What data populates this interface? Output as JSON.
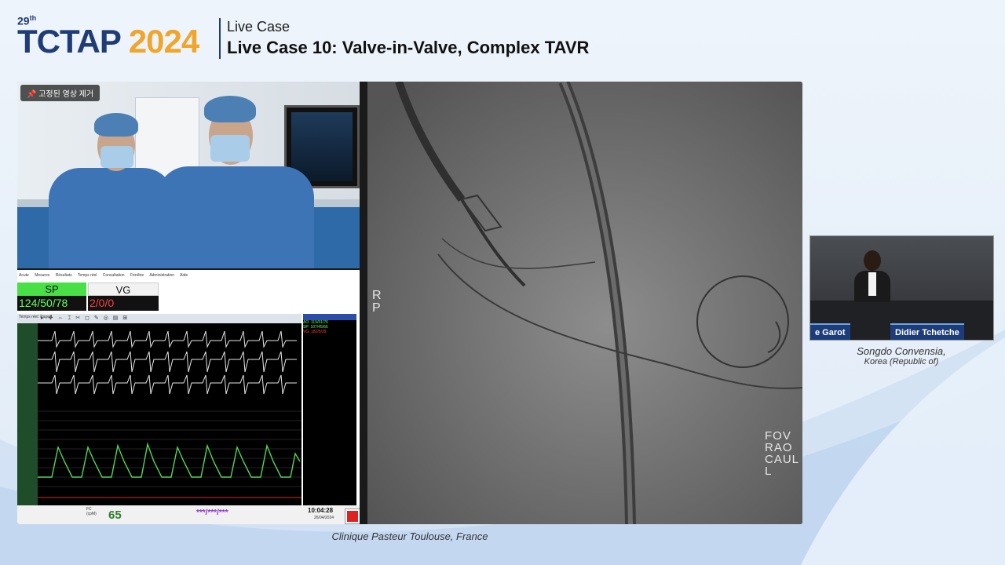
{
  "header": {
    "edition_number": "29",
    "edition_suffix": "th",
    "brand": "TCTAP",
    "year": "2024",
    "session": "Live Case",
    "title": "Live Case 10: Valve-in-Valve, Complex TAVR"
  },
  "camera": {
    "remove_pinned_label": "고정된 영상 제거"
  },
  "monitor": {
    "menu": [
      "Acute",
      "Mesures",
      "Résultats",
      "Temps réel",
      "Consultation",
      "Fenêtre",
      "Administration",
      "Aide"
    ],
    "sp": {
      "label": "SP",
      "value": "124/50/78"
    },
    "vg": {
      "label": "VG",
      "value": "2/0/0"
    },
    "wave_window_title": "Temps réel: Page 1",
    "side_lines": [
      "AO: 115/51/76",
      "SP: 107/45/66",
      "VG: 182/5/39"
    ],
    "footer": {
      "fc_label": "FC",
      "fc_unit": "(cpM)",
      "fc_value": "65",
      "bp_value": "***/***/***",
      "clock": "10:04:28",
      "date": "26/04/2024"
    }
  },
  "fluoro": {
    "side_letters": "R\nP",
    "corner_text": "FOV\nRAO\nCAUL\nL"
  },
  "pip": {
    "name_left": "e Garot",
    "name_right": "Didier Tchetche",
    "venue": "Songdo Convensia,",
    "country": "Korea (Republic of)"
  },
  "caption": "Clinique Pasteur Toulouse, France",
  "colors": {
    "brand_blue": "#1f3c74",
    "brand_orange": "#f0a62b",
    "sp_green": "#48e046",
    "name_tag_blue": "#1c3d7a"
  }
}
